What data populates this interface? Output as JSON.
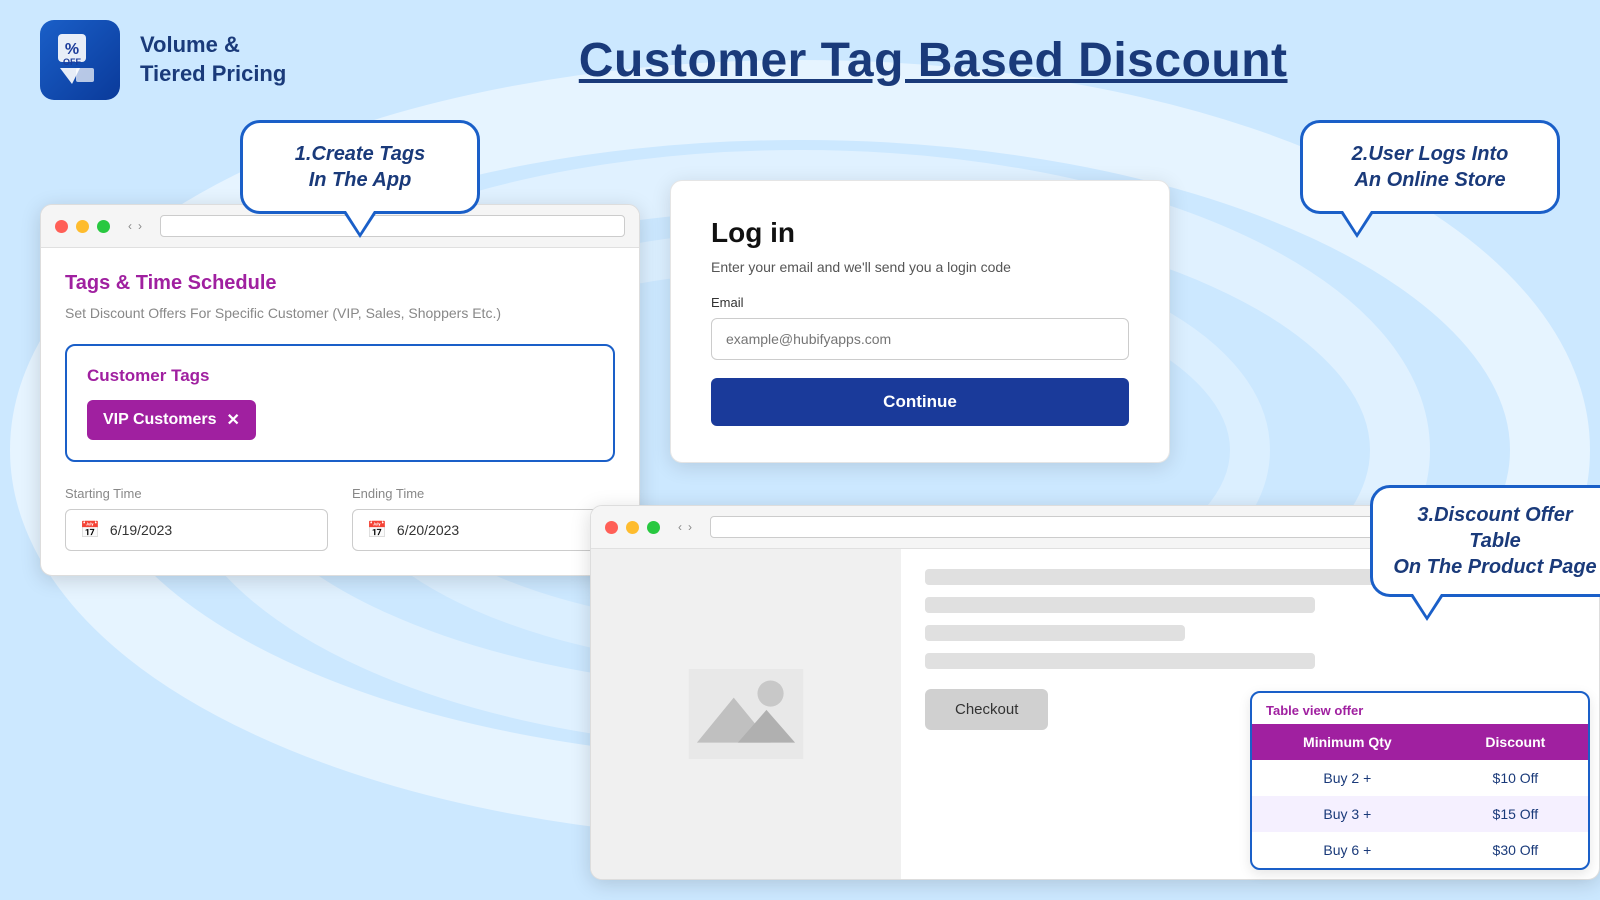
{
  "header": {
    "logo_line1": "Volume &",
    "logo_line2": "Tiered Pricing",
    "main_title": "Customer Tag Based Discount"
  },
  "bubble1": {
    "text": "1.Create Tags\nIn The App"
  },
  "bubble2": {
    "text": "2.User Logs Into\nAn Online Store"
  },
  "bubble3": {
    "text": "3.Discount Offer Table\nOn The Product Page"
  },
  "app_window": {
    "section_title": "Tags & Time Schedule",
    "section_subtitle": "Set Discount Offers For Specific Customer (VIP, Sales, Shoppers Etc.)",
    "customer_tags_label": "Customer Tags",
    "tag_chip_label": "VIP Customers",
    "starting_time_label": "Starting Time",
    "starting_time_value": "6/19/2023",
    "ending_time_label": "Ending Time",
    "ending_time_value": "6/20/2023"
  },
  "login": {
    "title": "Log in",
    "subtitle": "Enter your email and we'll send you a login code",
    "email_label": "Email",
    "email_placeholder": "example@hubifyapps.com",
    "continue_btn": "Continue"
  },
  "product_page": {
    "checkout_btn": "Checkout",
    "table_offer_label": "Table view offer",
    "table_headers": [
      "Minimum Qty",
      "Discount"
    ],
    "table_rows": [
      [
        "Buy 2 +",
        "$10 Off"
      ],
      [
        "Buy 3 +",
        "$15 Off"
      ],
      [
        "Buy 6 +",
        "$30 Off"
      ]
    ]
  }
}
